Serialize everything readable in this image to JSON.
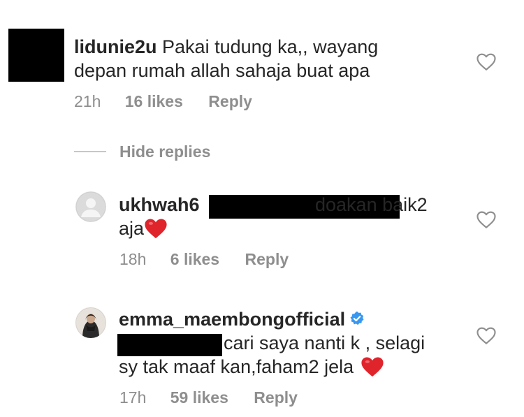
{
  "comments": [
    {
      "username": "lidunie2u",
      "text_line1": "Pakai tudung ka,, wayang",
      "text_line2": "depan rumah allah sahaja buat apa",
      "time": "21h",
      "likes": "16 likes",
      "reply": "Reply"
    }
  ],
  "hide_replies": "Hide replies",
  "replies": [
    {
      "username": "ukhwah6",
      "text_line1": "doakan baik2",
      "text_line2": "aja",
      "time": "18h",
      "likes": "6 likes",
      "reply": "Reply"
    },
    {
      "username": "emma_maembongofficial",
      "text_line1": "cari saya nanti k , selagi",
      "text_line2": "sy tak maaf kan,faham2 jela",
      "time": "17h",
      "likes": "59 likes",
      "reply": "Reply"
    }
  ],
  "icons": {
    "like": "heart-outline-icon",
    "verified": "verified-badge-icon",
    "emoji": "red-heart-emoji"
  },
  "colors": {
    "text": "#262626",
    "muted": "#8e8e8e",
    "verified": "#3897f0",
    "heart_emoji": "#e0242c",
    "redaction": "#000000"
  }
}
